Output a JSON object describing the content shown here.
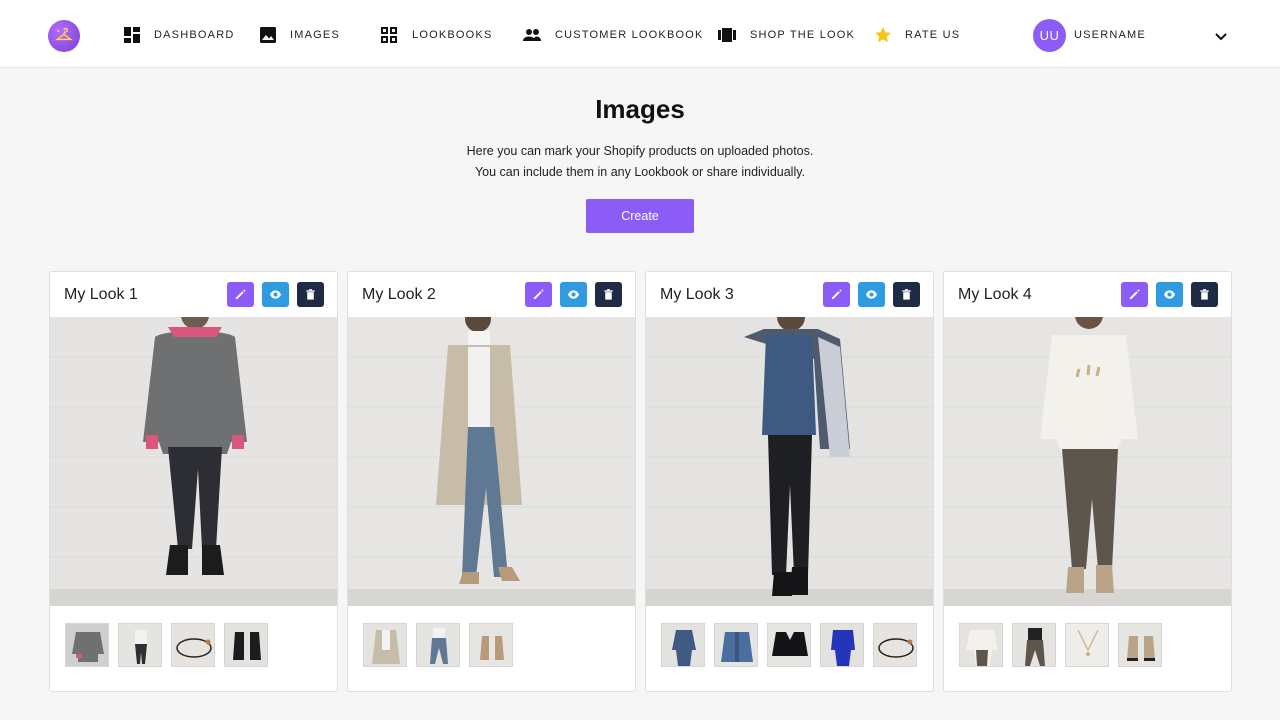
{
  "nav": {
    "items": [
      {
        "label": "DASHBOARD",
        "icon": "dashboard-icon"
      },
      {
        "label": "IMAGES",
        "icon": "image-icon"
      },
      {
        "label": "LOOKBOOKS",
        "icon": "grid-icon"
      },
      {
        "label": "CUSTOMER LOOKBOOK",
        "icon": "people-icon"
      },
      {
        "label": "SHOP THE LOOK",
        "icon": "carousel-icon"
      },
      {
        "label": "RATE US",
        "icon": "star-icon"
      }
    ],
    "avatar_initials": "UU",
    "username": "USERNAME"
  },
  "header": {
    "title": "Images",
    "subtitle_line1": "Here you can mark your Shopify products on uploaded photos.",
    "subtitle_line2": "You can include them in any Lookbook or share individually.",
    "create_label": "Create"
  },
  "cards": [
    {
      "title": "My Look 1",
      "thumb_count": 4
    },
    {
      "title": "My Look 2",
      "thumb_count": 3
    },
    {
      "title": "My Look 3",
      "thumb_count": 5
    },
    {
      "title": "My Look 4",
      "thumb_count": 4
    }
  ],
  "colors": {
    "accent": "#8b5cf6",
    "view": "#2f9be0",
    "delete": "#1f2a44",
    "star": "#f5c518"
  }
}
